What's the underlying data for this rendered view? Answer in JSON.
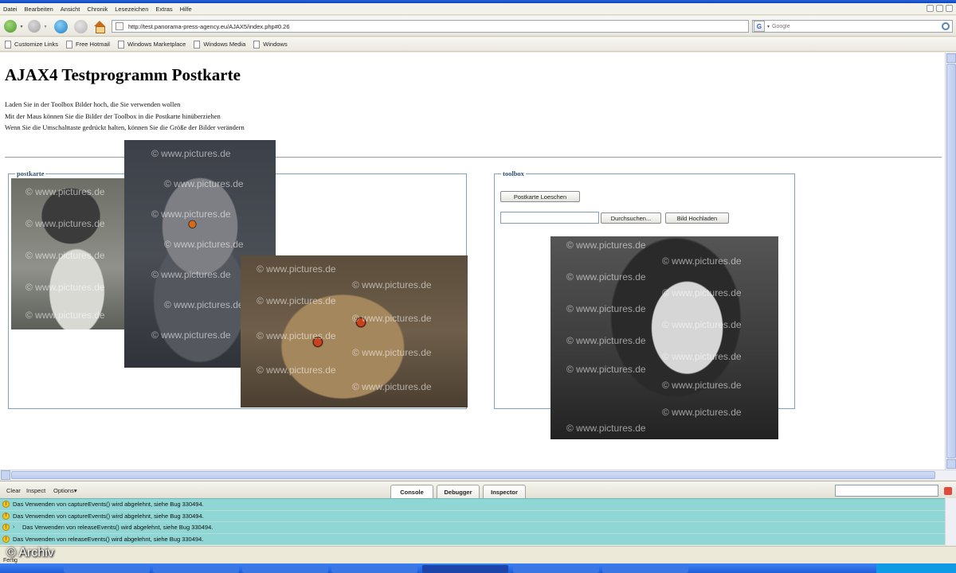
{
  "menu": [
    "Datei",
    "Bearbeiten",
    "Ansicht",
    "Chronik",
    "Lesezeichen",
    "Extras",
    "Hilfe"
  ],
  "address": {
    "url": "http://test.panorama-press-agency.eu/AJAX5/index.php#0.26"
  },
  "search": {
    "placeholder": "Google",
    "engine_glyph": "G"
  },
  "bookmarks": [
    "Customize Links",
    "Free Hotmail",
    "Windows Marketplace",
    "Windows Media",
    "Windows"
  ],
  "page": {
    "title": "AJAX4 Testprogramm Postkarte",
    "instructions": [
      "Laden Sie in der Toolbox Bilder hoch, die Sie verwenden wollen",
      "Mit der Maus können Sie die Bilder der Toolbox in die Postkarte hinüberziehen",
      "Wenn Sie die Umschalttaste gedrückt halten, können Sie die Größe der Bilder verändern"
    ],
    "postkarte_legend": "postkarte",
    "toolbox": {
      "legend": "toolbox",
      "clear_button": "Postkarte Loeschen",
      "browse_button": "Durchsuchen...",
      "upload_button": "Bild Hochladen"
    },
    "watermark": "© www.pictures.de"
  },
  "firebug": {
    "links": [
      "Clear",
      "Inspect",
      "Options▾"
    ],
    "tabs": [
      "Console",
      "Debugger",
      "Inspector"
    ],
    "active_tab": "Console",
    "messages": [
      "Das Verwenden von captureEvents() wird abgelehnt, siehe Bug 330494.",
      "Das Verwenden von captureEvents() wird abgelehnt, siehe Bug 330494.",
      "Das Verwenden von releaseEvents() wird abgelehnt, siehe Bug 330494.",
      "Das Verwenden von releaseEvents() wird abgelehnt, siehe Bug 330494."
    ]
  },
  "status": {
    "text": "Fertig"
  },
  "credit": "© Archiv",
  "colors": {
    "console_bg": "#8fd6d4",
    "fieldset_border": "#7fa3bd",
    "legend": "#2d4f73"
  }
}
